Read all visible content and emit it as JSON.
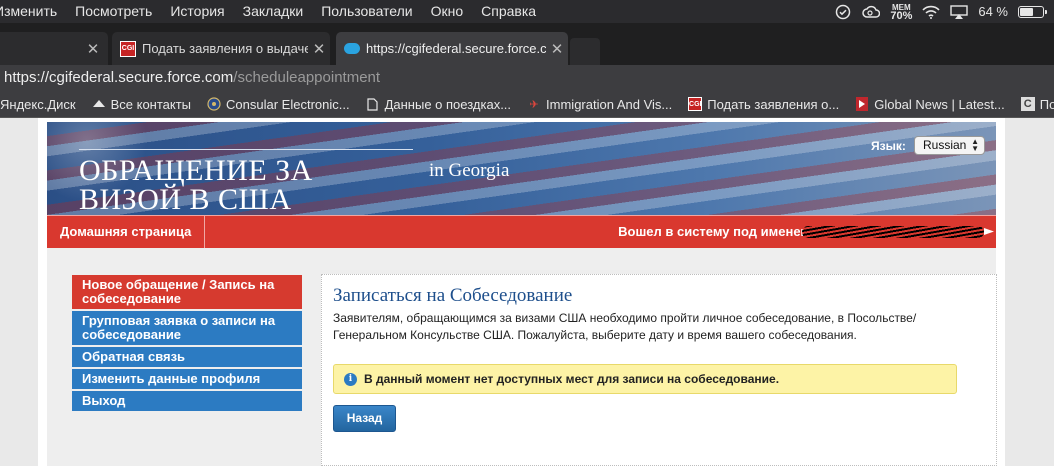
{
  "menubar": {
    "items": [
      "Изменить",
      "Посмотреть",
      "История",
      "Закладки",
      "Пользователи",
      "Окно",
      "Справка"
    ],
    "mem_label": "MEM",
    "mem_value": "70%",
    "battery_text": "64 %",
    "battery_level": 0.64
  },
  "tabs": [
    {
      "label": ""
    },
    {
      "label": "Подать заявления о выдаче в"
    },
    {
      "label": "https://cgifederal.secure.force.com/sc"
    }
  ],
  "address": {
    "host": "https://cgifederal.secure.force.com",
    "path": "/scheduleappointment"
  },
  "bookmarks": [
    {
      "label": "Яндекс.Диск",
      "icon": "yandex-disk-icon"
    },
    {
      "label": "Все контакты",
      "icon": "contacts-icon"
    },
    {
      "label": "Consular Electronic...",
      "icon": "seal-icon"
    },
    {
      "label": "Данные о поездках...",
      "icon": "document-icon"
    },
    {
      "label": "Immigration And Vis...",
      "icon": "plane-icon"
    },
    {
      "label": "Подать заявления о...",
      "icon": "cgi-icon"
    },
    {
      "label": "Global News | Latest...",
      "icon": "global-news-icon"
    },
    {
      "label": "Потерянные",
      "icon": "c-icon"
    }
  ],
  "banner": {
    "title_line1": "ОБРАЩЕНИЕ ЗА",
    "title_line2": "ВИЗОЙ В США",
    "country": "in Georgia",
    "language_label": "Язык:",
    "language_value": "Russian"
  },
  "navbar": {
    "home": "Домашняя страница",
    "logged_in": "Вошел в систему под именем"
  },
  "sidemenu": [
    {
      "label": "Новое обращение / Запись на собеседование",
      "active": true
    },
    {
      "label": "Групповая заявка о записи на собеседование",
      "active": false
    },
    {
      "label": "Обратная связь",
      "active": false
    },
    {
      "label": "Изменить данные профиля",
      "active": false
    },
    {
      "label": "Выход",
      "active": false
    }
  ],
  "main": {
    "title": "Записаться на Собеседование",
    "description": "Заявителям, обращающимся за визами США необходимо пройти личное собеседование, в Посольстве/ Генеральном Консульстве США. Пожалуйста, выберите дату и время вашего собеседования.",
    "alert": "В данный момент нет доступных мест для записи на собеседование.",
    "back_button": "Назад"
  },
  "colors": {
    "nav_red": "#d9382f",
    "menu_blue": "#2c7bc2",
    "title_blue": "#1e4f8c",
    "alert_yellow": "#fdf3a6"
  }
}
